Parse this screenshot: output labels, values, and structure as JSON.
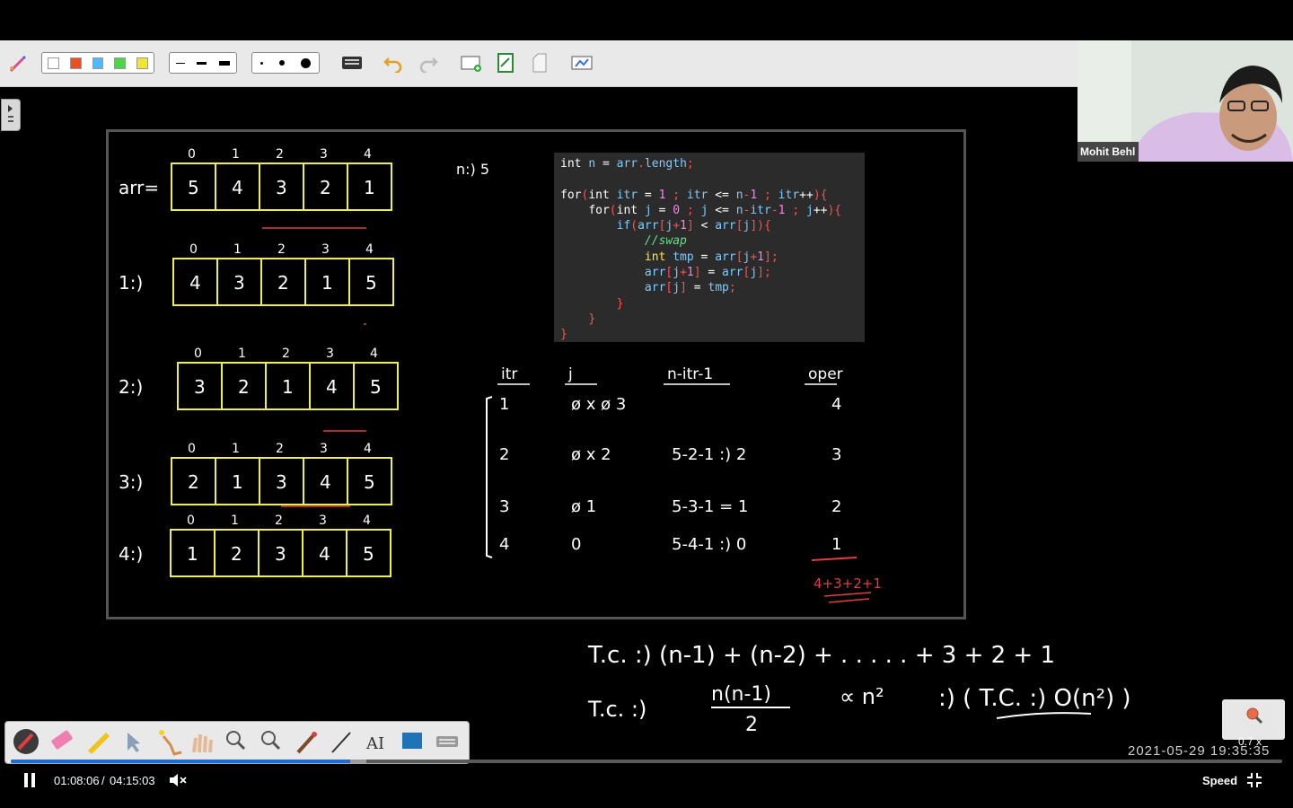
{
  "toolbar": {
    "colors": [
      "#ffffff",
      "#f04d1e",
      "#4fb8ff",
      "#52d14a",
      "#f2e62e"
    ],
    "tools": [
      "pen-settings-icon",
      "keyboard-icon",
      "undo-icon",
      "redo-icon",
      "add-page-icon",
      "export-icon",
      "page-icon",
      "screenshot-icon"
    ]
  },
  "webcam": {
    "name": "Mohit Behl"
  },
  "code": {
    "lines": [
      "int n = arr.length;",
      "",
      "for(int itr = 1 ; itr <= n-1 ; itr++){",
      "    for(int j = 0 ; j <= n-itr-1 ; j++){",
      "        if(arr[j+1] < arr[j]){",
      "            //swap",
      "            int tmp = arr[j+1];",
      "            arr[j+1] = arr[j];",
      "            arr[j] = tmp;",
      "        }",
      "    }",
      "}"
    ]
  },
  "board": {
    "arrays": [
      {
        "label": "arr=",
        "indices": [
          "0",
          "1",
          "2",
          "3",
          "4"
        ],
        "values": [
          "5",
          "4",
          "3",
          "2",
          "1"
        ]
      },
      {
        "label": "1:)",
        "indices": [
          "0",
          "1",
          "2",
          "3",
          "4"
        ],
        "values": [
          "4",
          "3",
          "2",
          "1",
          "5"
        ]
      },
      {
        "label": "2:)",
        "indices": [
          "0",
          "1",
          "2",
          "3",
          "4"
        ],
        "values": [
          "3",
          "2",
          "1",
          "4",
          "5"
        ]
      },
      {
        "label": "3:)",
        "indices": [
          "0",
          "1",
          "2",
          "3",
          "4"
        ],
        "values": [
          "2",
          "1",
          "3",
          "4",
          "5"
        ]
      },
      {
        "label": "4:)",
        "indices": [
          "0",
          "1",
          "2",
          "3",
          "4"
        ],
        "values": [
          "1",
          "2",
          "3",
          "4",
          "5"
        ]
      }
    ],
    "n_note": "n:) 5",
    "table_headers": [
      "itr",
      "j",
      "n-itr-1",
      "oper"
    ],
    "table_rows": [
      {
        "itr": "1",
        "j": "ø x ø 3",
        "calc": "",
        "oper": "4"
      },
      {
        "itr": "2",
        "j": "ø x 2",
        "calc": "5-2-1 :) 2",
        "oper": "3"
      },
      {
        "itr": "3",
        "j": "ø 1",
        "calc": "5-3-1 = 1",
        "oper": "2"
      },
      {
        "itr": "4",
        "j": "0",
        "calc": "5-4-1 :) 0",
        "oper": "1"
      }
    ],
    "sum_note": "4+3+2+1"
  },
  "formula": {
    "line1": "T.c. :) (n-1) + (n-2) + . . . . . + 3 + 2 + 1",
    "line2_lhs": "T.c. :)",
    "frac_num": "n(n-1)",
    "frac_den": "2",
    "prop": "∝ n²",
    "result": ":) ( T.C. :) O(n²) )"
  },
  "player": {
    "current_time": "01:08:06",
    "separator": "/",
    "total_time": "04:15:03",
    "progress": 0.267,
    "buffered": 0.28,
    "speed_label": "Speed",
    "timestamp": "2021-05-29 19:35:35",
    "zoom_label": "0.7 x"
  }
}
